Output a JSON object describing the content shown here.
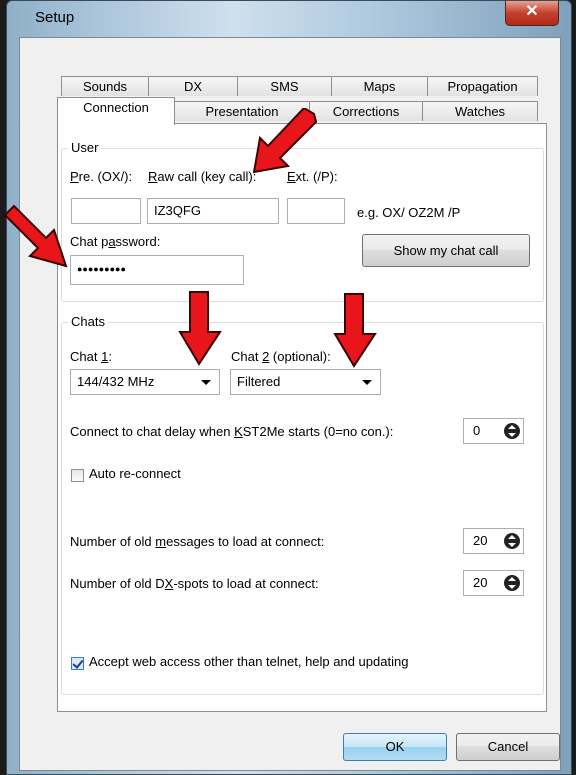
{
  "window": {
    "title": "Setup",
    "close_glyph": "✕"
  },
  "tabs_row1": [
    "Sounds",
    "DX",
    "SMS",
    "Maps",
    "Propagation"
  ],
  "tabs_row2": [
    "Connection",
    "Presentation",
    "Corrections",
    "Watches"
  ],
  "active_tab": "Connection",
  "user": {
    "group_title": "User",
    "pre_label": "Pre. (OX/):",
    "raw_label": "Raw call (key call):",
    "ext_label": "Ext. (/P):",
    "pre_value": "",
    "raw_value": "IZ3QFG",
    "ext_value": "",
    "example": "e.g. OX/  OZ2M  /P",
    "password_label": "Chat password:",
    "password_value": "●●●●●●●●●",
    "show_chat_call_button": "Show my chat call"
  },
  "chats": {
    "group_title": "Chats",
    "chat1_label": "Chat 1:",
    "chat2_label": "Chat 2 (optional):",
    "chat1_value": "144/432 MHz",
    "chat2_value": "Filtered",
    "delay_label": "Connect to chat delay when KST2Me starts (0=no con.):",
    "delay_value": "0",
    "auto_reconnect_label": "Auto re-connect",
    "auto_reconnect_checked": false,
    "old_messages_label": "Number of old messages to load at connect:",
    "old_messages_value": "20",
    "old_dxspots_label": "Number of old DX-spots to load at connect:",
    "old_dxspots_value": "20",
    "web_access_label": "Accept web access other than telnet, help and updating",
    "web_access_checked": true
  },
  "buttons": {
    "ok": "OK",
    "cancel": "Cancel"
  },
  "colors": {
    "annotation_arrow": "#e8151b",
    "ok_highlight": "#c9e8fb"
  }
}
